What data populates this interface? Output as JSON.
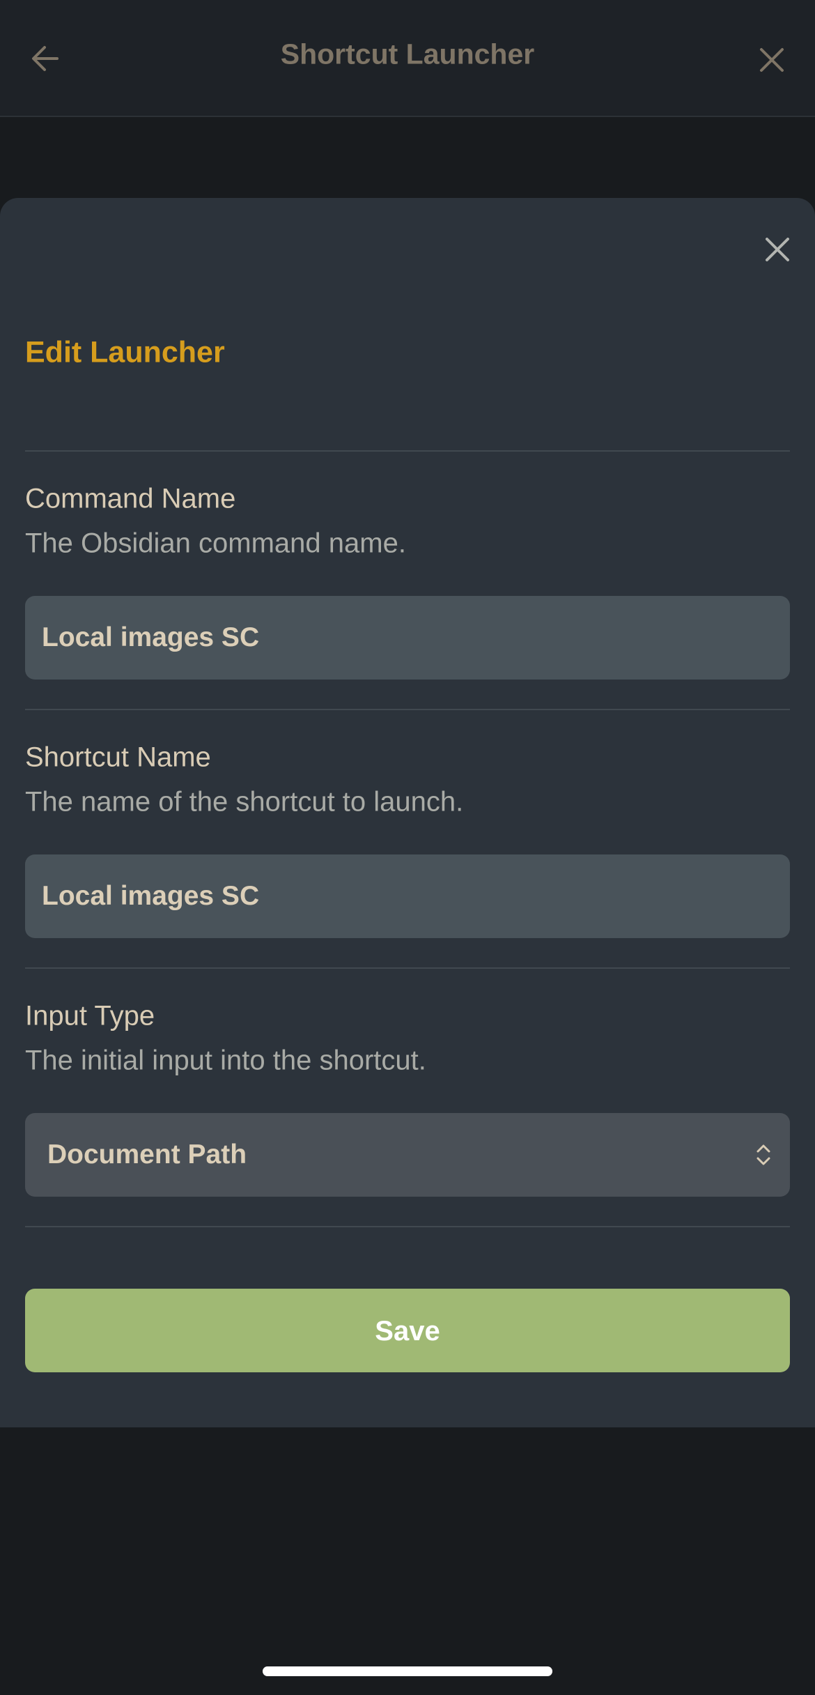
{
  "header": {
    "title": "Shortcut Launcher"
  },
  "modal": {
    "title": "Edit Launcher",
    "settings": [
      {
        "name": "Command Name",
        "description": "The Obsidian command name.",
        "value": "Local images SC"
      },
      {
        "name": "Shortcut Name",
        "description": "The name of the shortcut to launch.",
        "value": "Local images SC"
      },
      {
        "name": "Input Type",
        "description": "The initial input into the shortcut.",
        "value": "Document Path"
      }
    ],
    "save_label": "Save"
  },
  "icons": {
    "back": "arrow-left-icon",
    "close": "close-icon",
    "select": "chevron-up-down-icon"
  },
  "colors": {
    "accent_title": "#d69d1d",
    "save_button": "#a0b974",
    "modal_background": "#2c333b",
    "app_background": "#181b1e"
  }
}
